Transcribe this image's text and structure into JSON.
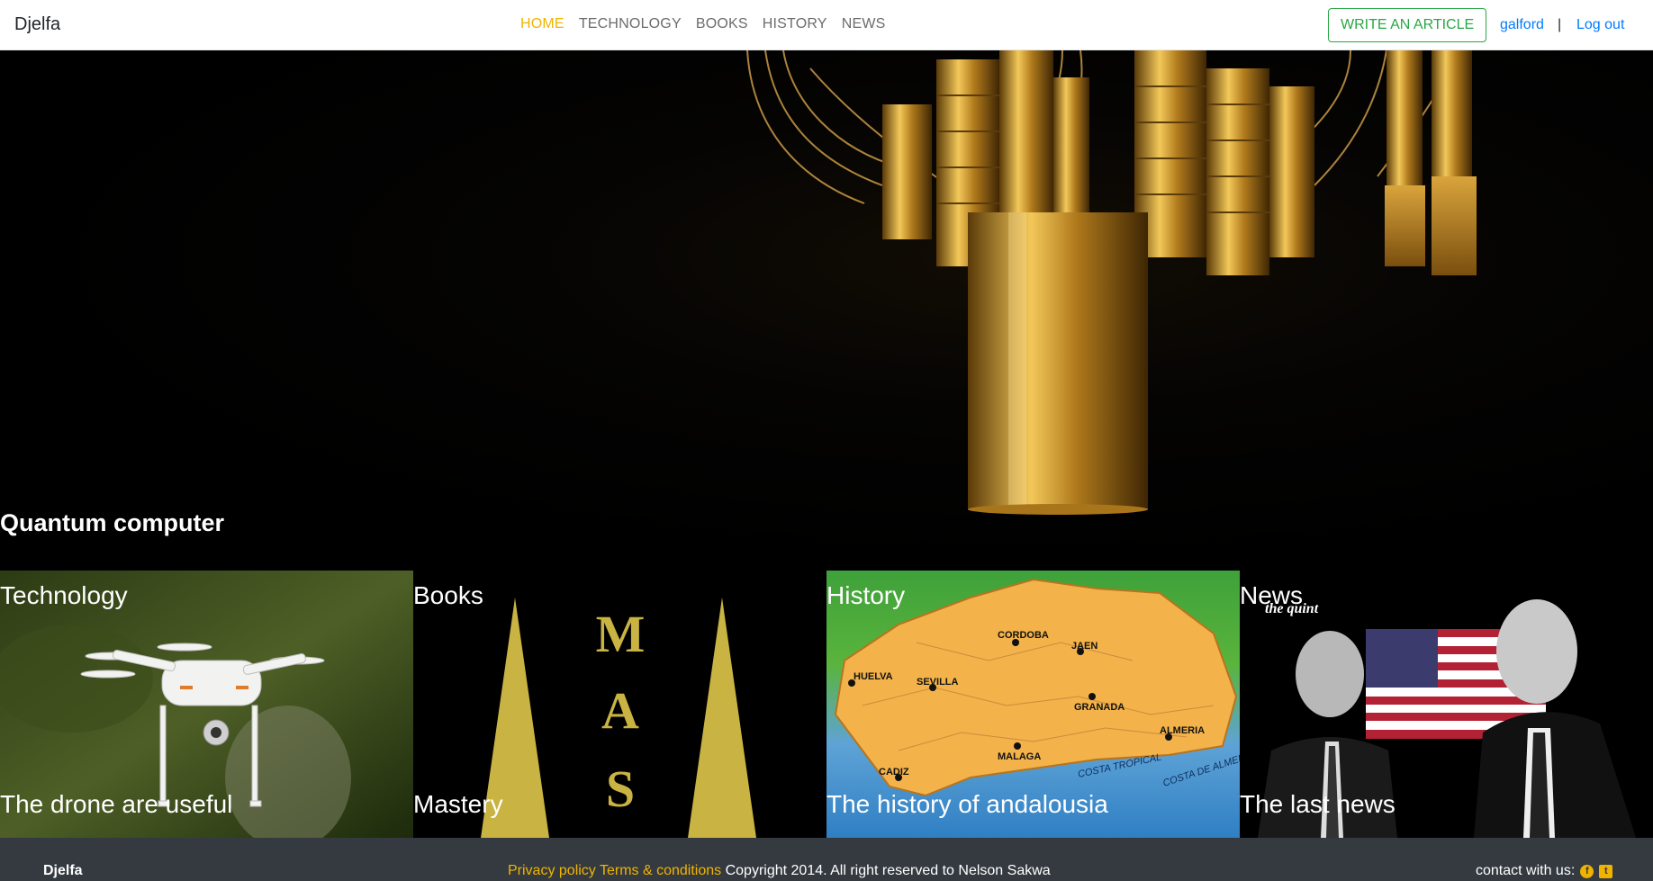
{
  "navbar": {
    "brand": "Djelfa",
    "links": [
      {
        "label": "HOME",
        "active": true
      },
      {
        "label": "TECHNOLOGY",
        "active": false
      },
      {
        "label": "BOOKS",
        "active": false
      },
      {
        "label": "HISTORY",
        "active": false
      },
      {
        "label": "NEWS",
        "active": false
      }
    ],
    "write_button": "WRITE AN ARTICLE",
    "username": "galford",
    "separator": "|",
    "logout": "Log out"
  },
  "hero": {
    "title": "Quantum computer",
    "image_icon": "quantum-computer-image"
  },
  "tiles": [
    {
      "category": "Technology",
      "title": "The drone are useful",
      "image_icon": "drone-image"
    },
    {
      "category": "Books",
      "title": "Mastery",
      "image_icon": "book-cover-image",
      "cover_letters": [
        "M",
        "A",
        "S"
      ]
    },
    {
      "category": "History",
      "title": "The history of andalousia",
      "image_icon": "andalusia-map-image",
      "map_labels": [
        "CORDOBA",
        "JAEN",
        "SEVILLA",
        "GRANADA",
        "HUELVA",
        "MALAGA",
        "ALMERIA",
        "CADIZ",
        "COSTA TROPICAL",
        "COSTA DE ALMERIA"
      ]
    },
    {
      "category": "News",
      "title": "The last news",
      "image_icon": "news-portrait-image",
      "watermark": "the quint"
    }
  ],
  "footer": {
    "brand": "Djelfa",
    "privacy": "Privacy policy",
    "terms": "Terms & conditions",
    "copyright": "Copyright 2014. All right reserved to Nelson Sakwa",
    "contact": "contact with us:",
    "social_icons": [
      "facebook-icon",
      "twitter-icon"
    ]
  },
  "colors": {
    "accent": "#f0b400",
    "link": "#007bff",
    "write_button": "#28a745",
    "footer_bg": "#343a40"
  }
}
